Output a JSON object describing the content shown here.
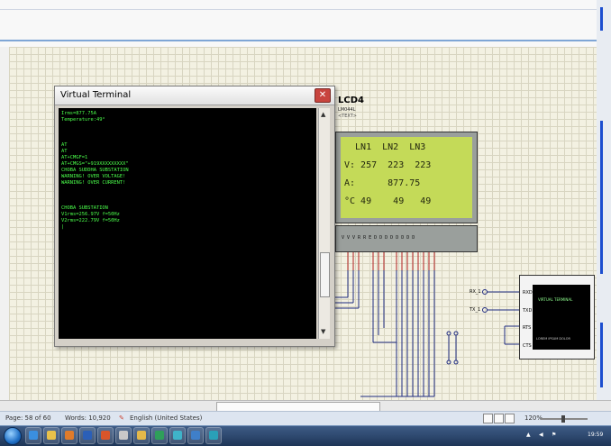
{
  "terminal": {
    "title": "Virtual Terminal",
    "close_icon": "close-icon",
    "lines": [
      "Irms=877.75A",
      "Temperature:49°",
      "",
      "",
      "",
      "AT",
      "AT",
      "AT+CMGF=1",
      "AT+CMGS=\"+919XXXXXXXXX\"",
      "CHOBA SUDDHA SUBSTATION",
      "WARNING! OVER VOLTAGE!",
      "WARNING! OVER CURRENT!",
      "",
      "",
      "",
      "CHOBA SUBSTATION",
      "V1rms=256.97V f=50Hz",
      "V2rms=222.79V f=50Hz",
      "|"
    ]
  },
  "lcd": {
    "name": "LCD4",
    "part": "LM044L",
    "text_placeholder": "<TEXT>",
    "row1": "  LN1  LN2  LN3",
    "row2": "V: 257  223  223",
    "row3": "A:      877.75",
    "row4": "°C 49    49   49",
    "pins": "V V V   R R E   D D D D D D D D"
  },
  "schematic": {
    "rx_label": "RX_1",
    "tx_label": "TX_1",
    "vt_pins": [
      "RXD",
      "TXD",
      "RTS",
      "CTS"
    ],
    "vt_screen_text_1": "VIRTUAL TERMINAL",
    "vt_screen_text_2": "LOREM IPSUM DOLOR"
  },
  "statusbar": {
    "page": "Page: 58 of 60",
    "words": "Words: 10,920",
    "language": "English (United States)",
    "zoom": "120%"
  },
  "taskbar": {
    "time": "19:59",
    "apps": [
      "ie-icon",
      "explorer-icon",
      "media-icon",
      "word-icon",
      "firefox-icon",
      "paint-icon",
      "folder-icon",
      "proteus-icon",
      "app-icon",
      "app-icon",
      "app-icon"
    ]
  },
  "colors": {
    "terminal_text": "#4bff4b",
    "lcd_background": "#c4da58",
    "accent_blue": "#1c4ecf"
  }
}
